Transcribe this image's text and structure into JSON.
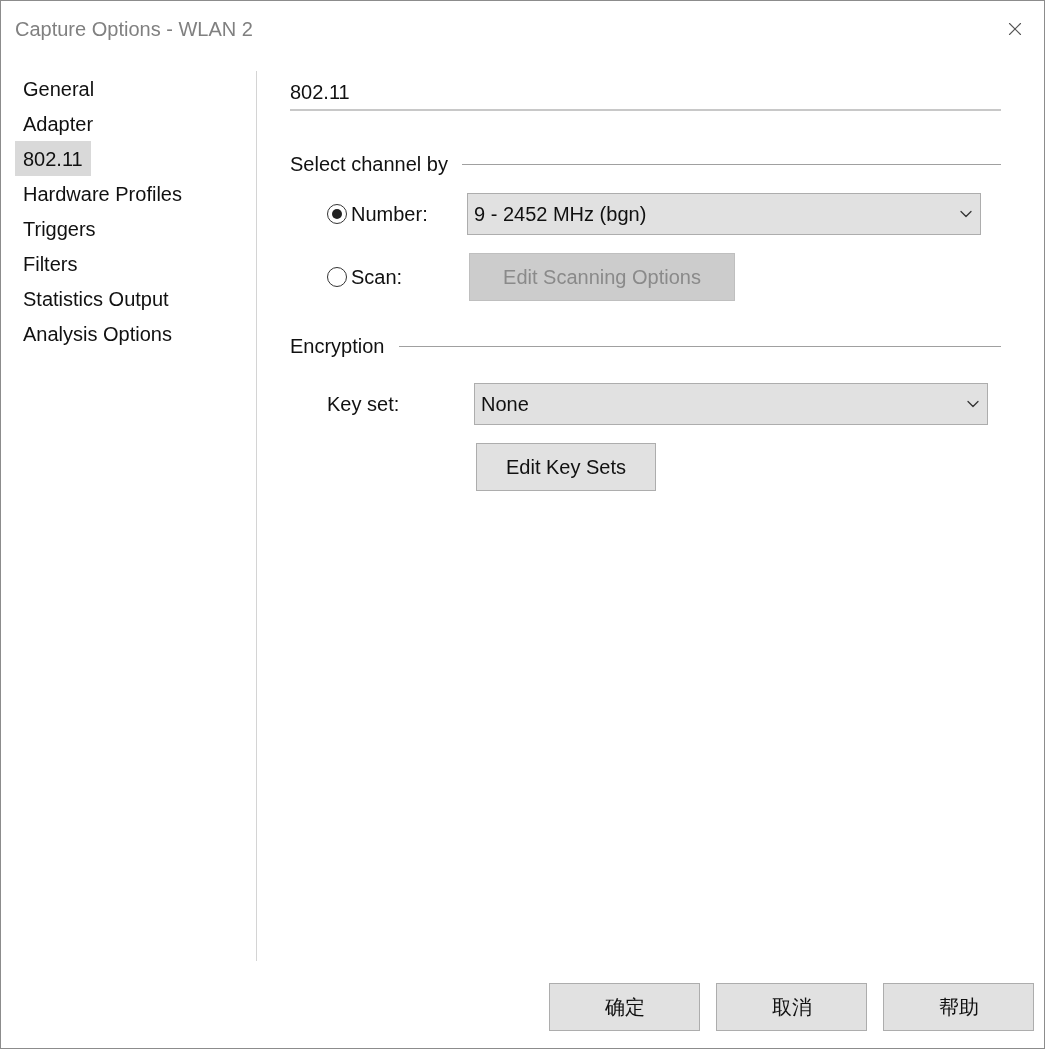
{
  "window": {
    "title": "Capture Options - WLAN 2"
  },
  "sidebar": {
    "items": [
      {
        "label": "General",
        "selected": false
      },
      {
        "label": "Adapter",
        "selected": false
      },
      {
        "label": "802.11",
        "selected": true
      },
      {
        "label": "Hardware Profiles",
        "selected": false
      },
      {
        "label": "Triggers",
        "selected": false
      },
      {
        "label": "Filters",
        "selected": false
      },
      {
        "label": "Statistics Output",
        "selected": false
      },
      {
        "label": "Analysis Options",
        "selected": false
      }
    ]
  },
  "page": {
    "heading": "802.11",
    "channel": {
      "title": "Select channel by",
      "number_option": {
        "label": "Number:",
        "selected": true
      },
      "channel_select": {
        "value": "9 - 2452 MHz (bgn)"
      },
      "scan_option": {
        "label": "Scan:",
        "selected": false
      },
      "scan_button": {
        "label": "Edit Scanning Options",
        "disabled": true
      }
    },
    "encryption": {
      "title": "Encryption",
      "key_set_label": "Key set:",
      "key_set_select": {
        "value": "None"
      },
      "edit_button": {
        "label": "Edit Key Sets",
        "disabled": false
      }
    }
  },
  "buttons": [
    {
      "label": "确定"
    },
    {
      "label": "取消"
    },
    {
      "label": "帮助"
    }
  ]
}
